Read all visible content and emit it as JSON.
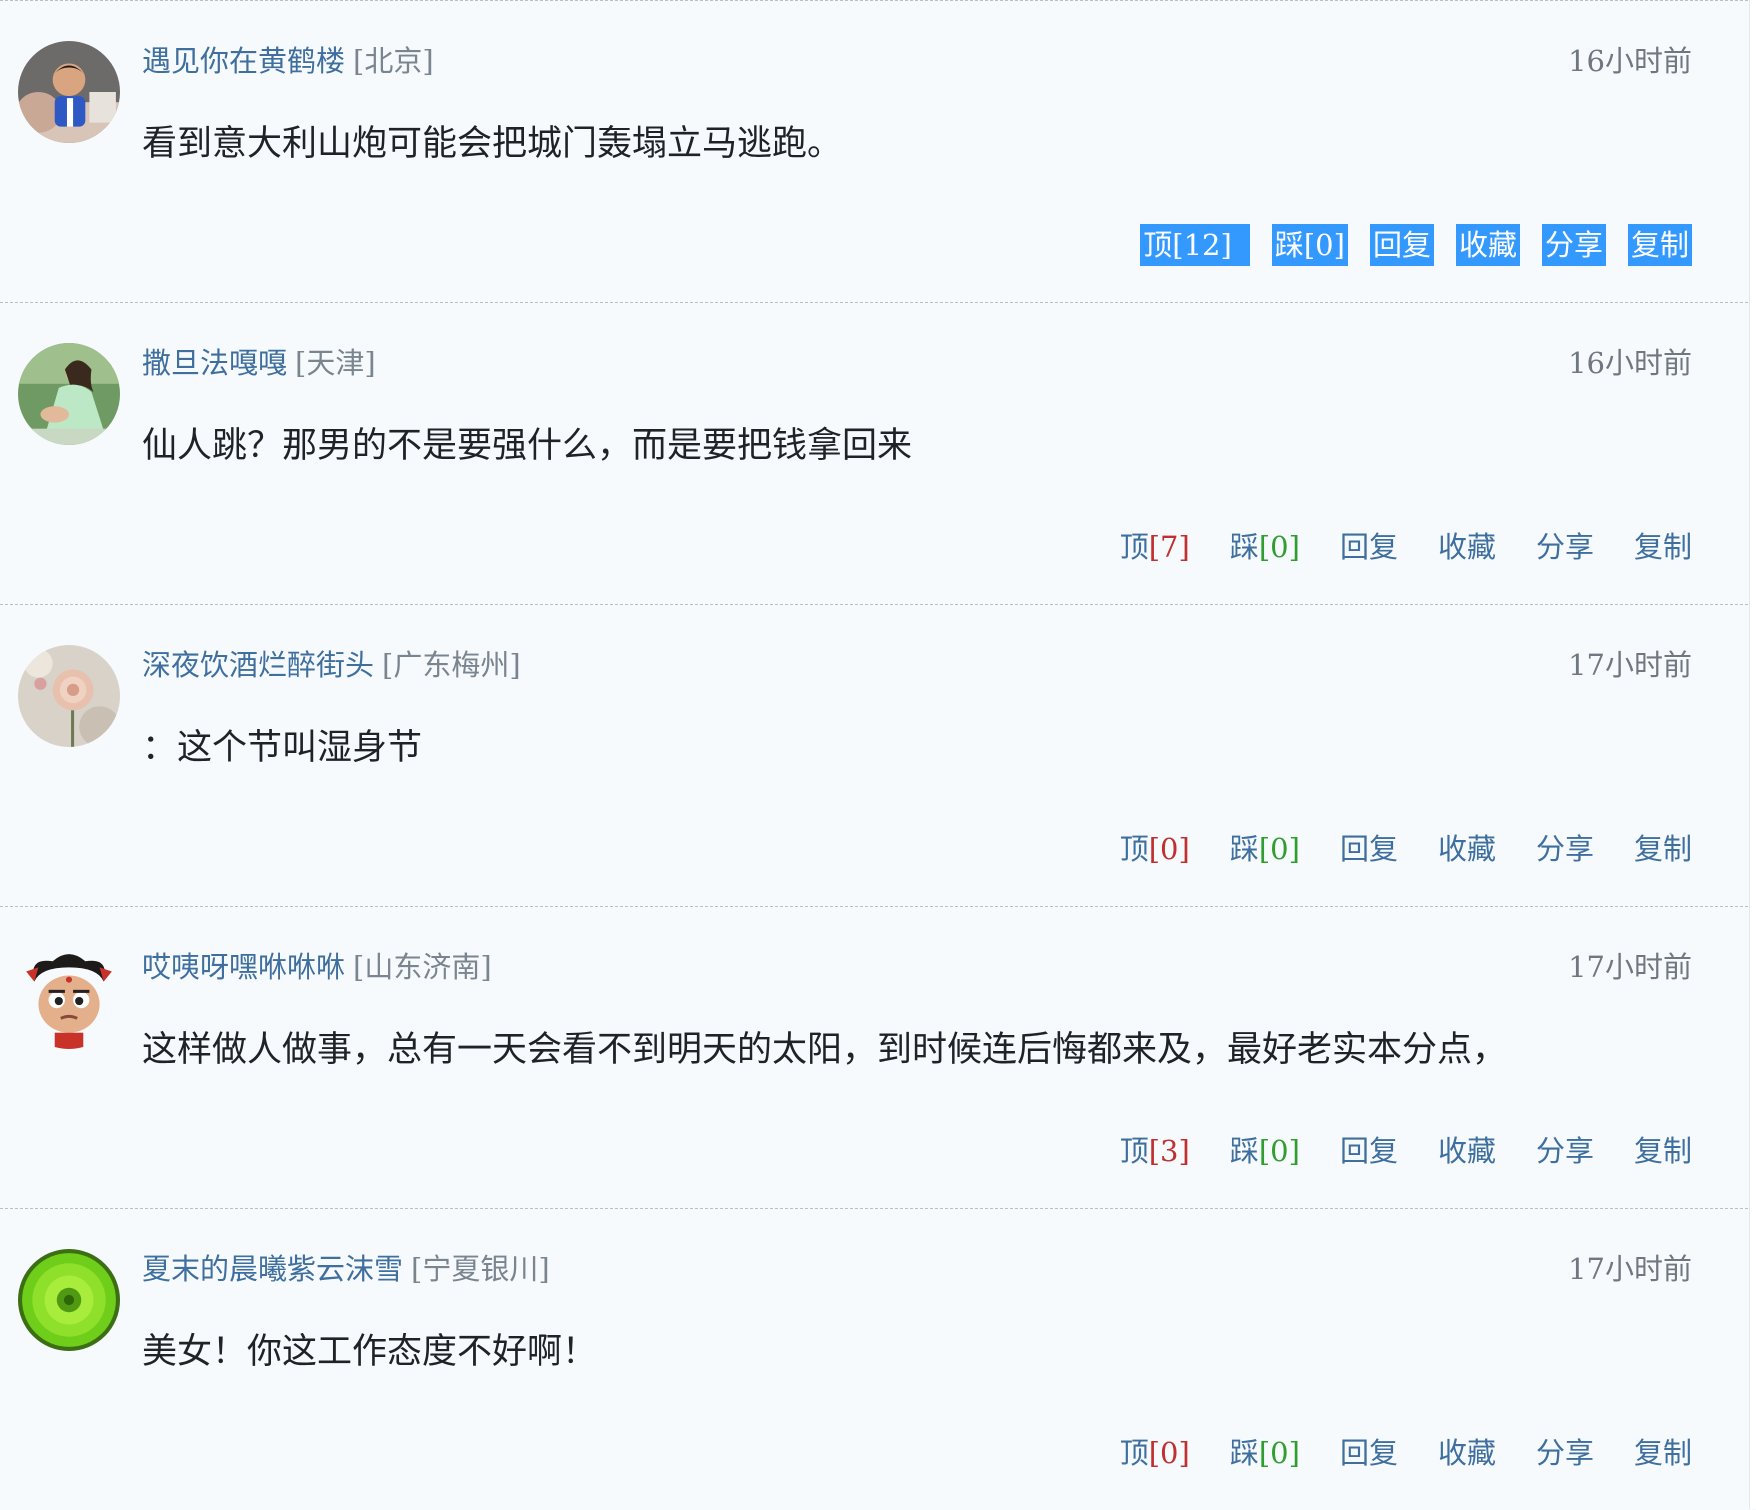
{
  "comments": [
    {
      "username": "遇见你在黄鹤楼",
      "location": "[北京]",
      "time": "16小时前",
      "text": "看到意大利山炮可能会把城门轰塌立马逃跑。",
      "up_label": "顶",
      "up_count": "[12]",
      "down_label": "踩",
      "down_count": "[0]",
      "reply": "回复",
      "favorite": "收藏",
      "share": "分享",
      "copy": "复制",
      "avatar_icon": "avatar-boy-photo"
    },
    {
      "username": "撒旦法嘎嘎",
      "location": "[天津]",
      "time": "16小时前",
      "text": "仙人跳？那男的不是要强什么，而是要把钱拿回来",
      "up_label": "顶",
      "up_count": "[7]",
      "down_label": "踩",
      "down_count": "[0]",
      "reply": "回复",
      "favorite": "收藏",
      "share": "分享",
      "copy": "复制",
      "avatar_icon": "avatar-woman-photo"
    },
    {
      "username": "深夜饮酒烂醉街头",
      "location": "[广东梅州]",
      "time": "17小时前",
      "text": "：这个节叫湿身节",
      "up_label": "顶",
      "up_count": "[0]",
      "down_label": "踩",
      "down_count": "[0]",
      "reply": "回复",
      "favorite": "收藏",
      "share": "分享",
      "copy": "复制",
      "avatar_icon": "avatar-rose-photo"
    },
    {
      "username": "哎咦呀嘿咻咻咻",
      "location": "[山东济南]",
      "time": "17小时前",
      "text": "这样做人做事，总有一天会看不到明天的太阳，到时候连后悔都来及，最好老实本分点，",
      "up_label": "顶",
      "up_count": "[3]",
      "down_label": "踩",
      "down_count": "[0]",
      "reply": "回复",
      "favorite": "收藏",
      "share": "分享",
      "copy": "复制",
      "avatar_icon": "avatar-cartoon-character"
    },
    {
      "username": "夏末的晨曦紫云沫雪",
      "location": "[宁夏银川]",
      "time": "17小时前",
      "text": "美女！你这工作态度不好啊！",
      "up_label": "顶",
      "up_count": "[0]",
      "down_label": "踩",
      "down_count": "[0]",
      "reply": "回复",
      "favorite": "收藏",
      "share": "分享",
      "copy": "复制",
      "avatar_icon": "avatar-green-flower-photo"
    }
  ],
  "colors": {
    "background": "#f6fafd",
    "username": "#3f6f9e",
    "active_button": "#3399ff",
    "up_count": "#c03030",
    "down_count": "#2f9e2f"
  }
}
